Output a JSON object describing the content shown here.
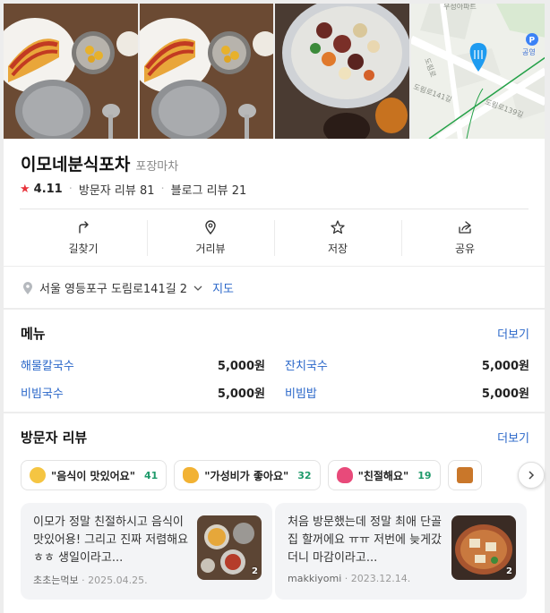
{
  "place": {
    "name": "이모네분식포차",
    "category": "포장마차",
    "rating": "4.11",
    "visitor_reviews": "방문자 리뷰 81",
    "blog_reviews": "블로그 리뷰 21"
  },
  "map_labels": {
    "top": "우성아파트",
    "road1": "도림로",
    "road2": "도림로141길",
    "road3": "도림로139길",
    "park": "공영"
  },
  "actions": [
    {
      "label": "길찾기",
      "icon": "directions-icon"
    },
    {
      "label": "거리뷰",
      "icon": "street-view-icon"
    },
    {
      "label": "저장",
      "icon": "star-icon"
    },
    {
      "label": "공유",
      "icon": "share-icon"
    }
  ],
  "address": {
    "text": "서울 영등포구 도림로141길 2",
    "map_link": "지도"
  },
  "menu": {
    "title": "메뉴",
    "more": "더보기",
    "items": [
      {
        "name": "해물칼국수",
        "price": "5,000원"
      },
      {
        "name": "잔치국수",
        "price": "5,000원"
      },
      {
        "name": "비빔국수",
        "price": "5,000원"
      },
      {
        "name": "비빔밥",
        "price": "5,000원"
      }
    ]
  },
  "reviews": {
    "title": "방문자 리뷰",
    "more": "더보기",
    "chips": [
      {
        "label": "\"음식이 맛있어요\"",
        "count": "41",
        "color": "#f5c542"
      },
      {
        "label": "\"가성비가 좋아요\"",
        "count": "32",
        "color": "#f2b233"
      },
      {
        "label": "\"친절해요\"",
        "count": "19",
        "color": "#e84a7a"
      }
    ],
    "cards": [
      {
        "text": "이모가 정말 친절하시고 음식이 맛있어용! 그리고 진짜 저렴해요 ㅎㅎ 생일이라고...",
        "author": "초초는먹보",
        "date": "2025.04.25.",
        "photo_count": "2"
      },
      {
        "text": "처음 방문했는데 정말 최애 단골집 할꺼에요 ㅠㅠ 저번에 늦게갔더니 마감이라고...",
        "author": "makkiyomi",
        "date": "2023.12.14.",
        "photo_count": "2"
      }
    ]
  },
  "colors": {
    "accent_link": "#2a67c9",
    "rating_star": "#e8333b",
    "count_green": "#1f9a6b"
  }
}
